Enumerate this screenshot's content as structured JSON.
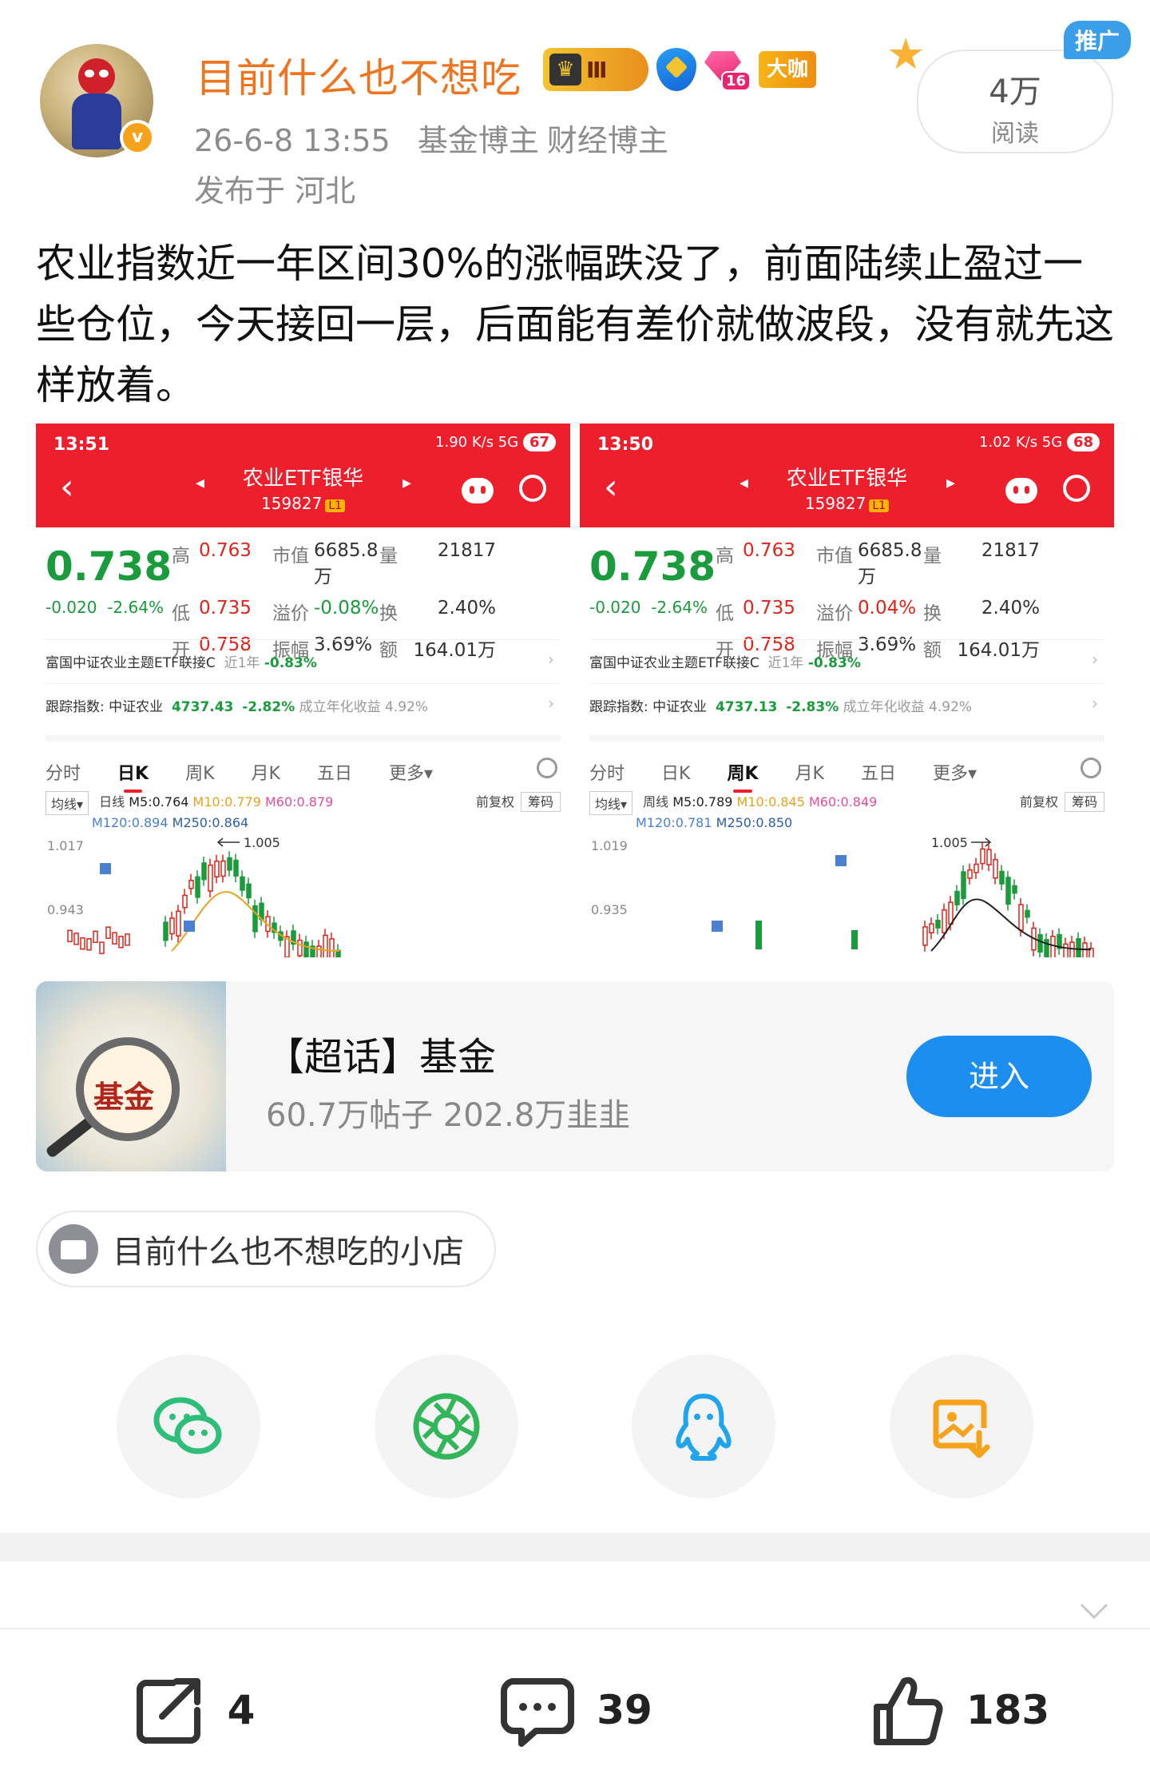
{
  "author": {
    "name": "目前什么也不想吃",
    "avatar_badge": "v",
    "level_badge": "Ⅲ",
    "gem_level": "16",
    "daka_label": "大咖",
    "date": "26-6-8 13:55",
    "tags": [
      "基金博主",
      "财经博主"
    ],
    "location": "发布于 河北"
  },
  "promo": {
    "read_count": "4万",
    "read_label": "阅读",
    "tag": "推广"
  },
  "post": {
    "text": "农业指数近一年区间30%的涨幅跌没了，前面陆续止盈过一些仓位，今天接回一层，后面能有差价就做波段，没有就先这样放着。"
  },
  "screenshots": [
    {
      "time": "13:51",
      "net": "1.90 K/s 5G",
      "battery": "67",
      "title": "农业ETF银华",
      "code": "159827",
      "code_tag": "L1",
      "price": "0.738",
      "change": "-0.020",
      "change_pct": "-2.64%",
      "grid": [
        [
          "高",
          "0.763",
          "市值",
          "6685.8万",
          "量",
          "21817"
        ],
        [
          "低",
          "0.735",
          "溢价",
          "-0.08%",
          "换",
          "2.40%"
        ],
        [
          "开",
          "0.758",
          "振幅",
          "3.69%",
          "额",
          "164.01万"
        ]
      ],
      "link_fund": "富国中证农业主题ETF联接C",
      "link_period": "近1年",
      "link_return": "-0.83%",
      "index_label": "跟踪指数: 中证农业",
      "index_value": "4737.43",
      "index_change": "-2.82%",
      "index_annual": "成立年化收益 4.92%",
      "tabs": [
        "分时",
        "日K",
        "周K",
        "月K",
        "五日",
        "更多▾"
      ],
      "active_tab": 1,
      "avg_label": "均线▾",
      "period_label": "日线",
      "m5": "M5:0.764",
      "m10": "M10:0.779",
      "m60": "M60:0.879",
      "m120": "M120:0.894",
      "m250": "M250:0.864",
      "adjust": "前复权",
      "chip": "筹码",
      "ymax": "1.017",
      "ymin": "0.943",
      "peak": "1.005"
    },
    {
      "time": "13:50",
      "net": "1.02 K/s 5G",
      "battery": "68",
      "title": "农业ETF银华",
      "code": "159827",
      "code_tag": "L1",
      "price": "0.738",
      "change": "-0.020",
      "change_pct": "-2.64%",
      "grid": [
        [
          "高",
          "0.763",
          "市值",
          "6685.8万",
          "量",
          "21817"
        ],
        [
          "低",
          "0.735",
          "溢价",
          "0.04%",
          "换",
          "2.40%"
        ],
        [
          "开",
          "0.758",
          "振幅",
          "3.69%",
          "额",
          "164.01万"
        ]
      ],
      "link_fund": "富国中证农业主题ETF联接C",
      "link_period": "近1年",
      "link_return": "-0.83%",
      "index_label": "跟踪指数: 中证农业",
      "index_value": "4737.13",
      "index_change": "-2.83%",
      "index_annual": "成立年化收益 4.92%",
      "tabs": [
        "分时",
        "日K",
        "周K",
        "月K",
        "五日",
        "更多▾"
      ],
      "active_tab": 2,
      "avg_label": "均线▾",
      "period_label": "周线",
      "m5": "M5:0.789",
      "m10": "M10:0.845",
      "m60": "M60:0.849",
      "m120": "M120:0.781",
      "m250": "M250:0.850",
      "adjust": "前复权",
      "chip": "筹码",
      "ymax": "1.019",
      "ymin": "0.935",
      "peak": "1.005"
    }
  ],
  "topic": {
    "title": "【超话】基金",
    "image_text": "基金",
    "stats": "60.7万帖子 202.8万韭韭",
    "button": "进入"
  },
  "shop": {
    "label": "目前什么也不想吃的小店"
  },
  "share": [
    "wechat-icon",
    "moments-icon",
    "qq-icon",
    "save-image-icon"
  ],
  "actions": {
    "repost_count": "4",
    "comment_count": "39",
    "like_count": "183"
  },
  "colors": {
    "username": "#ee7420",
    "brand_red": "#ee1f2c",
    "down_green": "#1a9b3c",
    "enter_button": "#1c8ef0"
  }
}
